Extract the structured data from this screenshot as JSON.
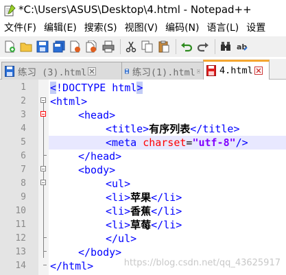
{
  "window": {
    "title": "*C:\\Users\\ASUS\\Desktop\\4.html - Notepad++"
  },
  "menu": {
    "items": [
      "文件(F)",
      "编辑(E)",
      "搜索(S)",
      "视图(V)",
      "编码(N)",
      "语言(L)",
      "设置"
    ]
  },
  "tabs": [
    {
      "label": "练习 (3).html",
      "active": false
    },
    {
      "label": "练习(1).html",
      "active": false
    },
    {
      "label": "4.html",
      "active": true
    }
  ],
  "editor": {
    "line_numbers": [
      "1",
      "2",
      "3",
      "4",
      "5",
      "6",
      "7",
      "8",
      "9",
      "10",
      "11",
      "12",
      "13",
      "14"
    ],
    "lines": [
      {
        "t1": "<",
        "t2": "!DOCTYPE html",
        "t3": ">"
      },
      {
        "tag": "<html>"
      },
      {
        "tag": "<head>"
      },
      {
        "open": "<title>",
        "text": "有序列表",
        "close": "</title>"
      },
      {
        "open": "<meta ",
        "attr": "charset",
        "eq": "=",
        "val": "\"utf-8\"",
        "close": "/>"
      },
      {
        "tag": "</head>"
      },
      {
        "tag": "<body>"
      },
      {
        "tag": "<ul>"
      },
      {
        "open": "<li>",
        "text": "苹果",
        "close": "</li>"
      },
      {
        "open": "<li>",
        "text": "香蕉",
        "close": "</li>"
      },
      {
        "open": "<li>",
        "text": "草莓",
        "close": "</li>"
      },
      {
        "tag": "</ul>"
      },
      {
        "tag": "</body>"
      },
      {
        "tag": "</html>"
      }
    ]
  },
  "watermark": "https://blog.csdn.net/qq_43625917",
  "colors": {
    "tag": "#0000ff",
    "attr": "#ff0000",
    "value": "#8000ff",
    "current_line": "#e8e8ff",
    "active_tab_accent": "#f4a630"
  }
}
